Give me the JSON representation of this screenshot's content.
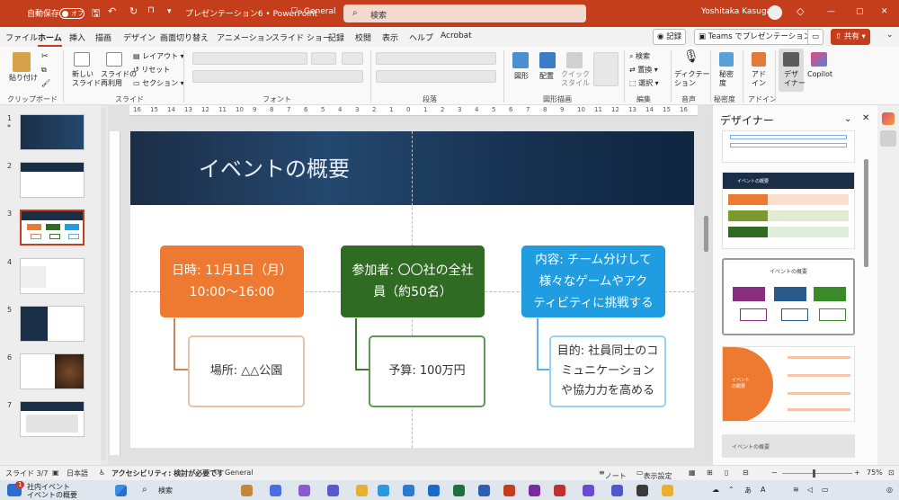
{
  "titlebar": {
    "autosave_label": "自動保存",
    "autosave_state": "オフ",
    "doc_title": "プレゼンテーション6 • PowerPoint",
    "sensitivity": "General",
    "search_placeholder": "検索",
    "user_name": "Yoshitaka Kasugai",
    "min": "—",
    "max": "▢",
    "close": "✕"
  },
  "tabs": [
    "ファイル",
    "ホーム",
    "挿入",
    "描画",
    "デザイン",
    "画面切り替え",
    "アニメーション",
    "スライド ショー",
    "記録",
    "校閲",
    "表示",
    "ヘルプ",
    "Acrobat"
  ],
  "tab_buttons": {
    "record": "記録",
    "teams": "Teams でプレゼンテーション",
    "share": "共有"
  },
  "ribbon": {
    "groups": {
      "clipboard": "クリップボード",
      "slides": "スライド",
      "font": "フォント",
      "paragraph": "段落",
      "drawing": "図形描画",
      "editing": "編集",
      "voice": "音声",
      "sensitivity": "秘密度",
      "addins": "アドイン"
    },
    "paste": "貼り付け",
    "new_slide": "新しい\nスライド",
    "reuse_slide": "スライドの\n再利用",
    "layout": "レイアウト",
    "reset": "リセット",
    "section": "セクション",
    "shape": "図形",
    "arrange": "配置",
    "quick_styles": "クイック\nスタイル",
    "find": "検索",
    "replace": "置換",
    "select": "選択",
    "dictate": "ディクテー\nション",
    "sensitivity_btn": "秘密\n度",
    "addins_btn": "アド\nイン",
    "designer_btn": "デザ\nイナー",
    "copilot": "Copilot"
  },
  "thumbnails": [
    {
      "num": "1",
      "star": "*"
    },
    {
      "num": "2"
    },
    {
      "num": "3"
    },
    {
      "num": "4"
    },
    {
      "num": "5"
    },
    {
      "num": "6"
    },
    {
      "num": "7"
    }
  ],
  "slide": {
    "title": "イベントの概要",
    "top_boxes": [
      {
        "text": "日時: 11月1日（月）\n10:00〜16:00",
        "color": "#ee7a32"
      },
      {
        "text": "参加者: 〇〇社の全社\n員（約50名）",
        "color": "#2f6b23"
      },
      {
        "text": "内容: チーム分けして\n様々なゲームやアク\nティビティに挑戦する",
        "color": "#1f9de0"
      }
    ],
    "bottom_boxes": [
      {
        "text": "場所: △△公園",
        "color": "#c9875a"
      },
      {
        "text": "予算: 100万円",
        "color": "#3d7b31"
      },
      {
        "text": "目的: 社員同士のコ\nミュニケーション\nや協力力を高める",
        "color": "#5db3e6"
      }
    ]
  },
  "designer": {
    "title": "デザイナー",
    "card_title": "イベントの概要",
    "card4_title": "イベント\nの概要",
    "card5_title": "イベントの概要"
  },
  "status": {
    "slide_pos": "スライド 3/7",
    "language": "日本語",
    "accessibility": "アクセシビリティ: 検討が必要です",
    "sensitivity": "General",
    "notes": "ノート",
    "display": "表示設定",
    "zoom": "75%"
  },
  "taskbar": {
    "app_line1": "社内イベント",
    "app_line2": "イベントの概要",
    "badge": "1",
    "search": "検索",
    "ime": "あ",
    "lang": "A"
  },
  "colors": {
    "accent": "#c43e1c",
    "orange": "#ee7a32",
    "green": "#2f6b23",
    "blue": "#1f9de0"
  }
}
